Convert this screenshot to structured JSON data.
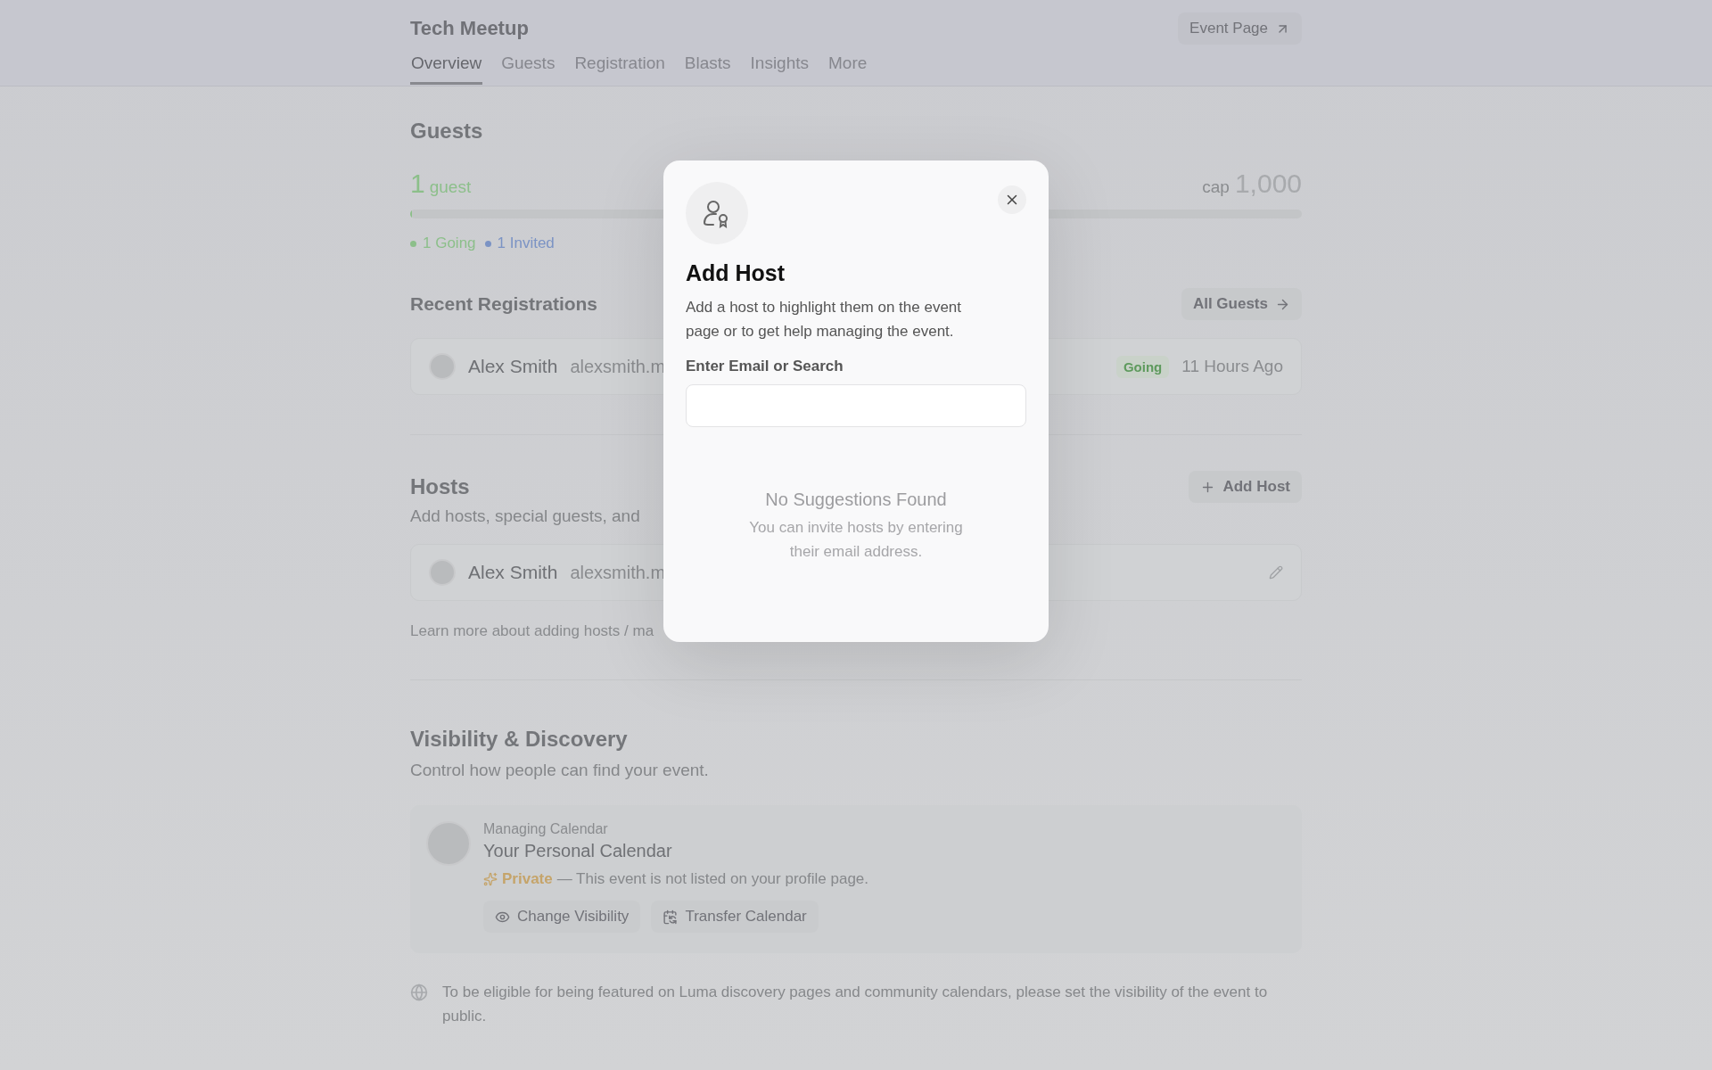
{
  "header": {
    "title": "Tech Meetup",
    "event_page_button": "Event Page"
  },
  "tabs": [
    {
      "label": "Overview",
      "selected": true
    },
    {
      "label": "Guests",
      "selected": false
    },
    {
      "label": "Registration",
      "selected": false
    },
    {
      "label": "Blasts",
      "selected": false
    },
    {
      "label": "Insights",
      "selected": false
    },
    {
      "label": "More",
      "selected": false
    }
  ],
  "guests": {
    "heading": "Guests",
    "count": "1",
    "count_unit": "guest",
    "cap_label": "cap",
    "cap_value": "1,000",
    "level": 0.002,
    "legend": [
      {
        "label": "1 Going",
        "color": "#8cbf8a"
      },
      {
        "label": "1 Invited",
        "color": "#7b93c4"
      }
    ]
  },
  "recent_registrations": {
    "heading": "Recent Registrations",
    "button": "All Guests",
    "rows": [
      {
        "name": "Alex Smith",
        "email": "alexsmith.m",
        "status": "Going",
        "time": "11 Hours Ago"
      }
    ]
  },
  "hosts": {
    "heading": "Hosts",
    "subtitle": "Add hosts, special guests, and",
    "button": "Add Host",
    "rows": [
      {
        "name": "Alex Smith",
        "email": "alexsmith.m"
      }
    ],
    "footnote": "Learn more about adding hosts / ma"
  },
  "visibility": {
    "heading": "Visibility & Discovery",
    "subtitle": "Control how people can find your event.",
    "calendar": {
      "label": "Managing Calendar",
      "name": "Your Personal Calendar",
      "status": "Private",
      "status_text": "— This event is not listed on your profile page.",
      "buttons": [
        {
          "label": "Change Visibility",
          "kind": "eye"
        },
        {
          "label": "Transfer Calendar",
          "kind": "calendar"
        }
      ]
    },
    "note": "To be eligible for being featured on Luma discovery pages and community calendars, please set the visibility of the event to public."
  },
  "modal": {
    "title": "Add Host",
    "description": "Add a host to highlight them on the event page or to get help managing the event.",
    "field_label": "Enter Email or Search",
    "empty_title": "No Suggestions Found",
    "empty_text": "You can invite hosts by entering their email address."
  }
}
